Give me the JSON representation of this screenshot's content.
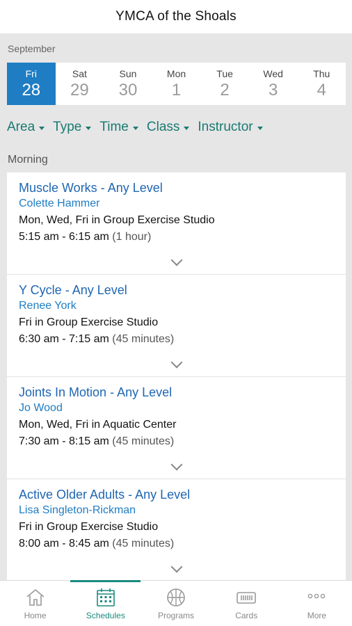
{
  "header": {
    "title": "YMCA of the Shoals"
  },
  "calendar": {
    "month": "September",
    "days": [
      {
        "dow": "Fri",
        "num": "28",
        "selected": true
      },
      {
        "dow": "Sat",
        "num": "29"
      },
      {
        "dow": "Sun",
        "num": "30"
      },
      {
        "dow": "Mon",
        "num": "1"
      },
      {
        "dow": "Tue",
        "num": "2"
      },
      {
        "dow": "Wed",
        "num": "3"
      },
      {
        "dow": "Thu",
        "num": "4"
      }
    ]
  },
  "filters": [
    "Area",
    "Type",
    "Time",
    "Class",
    "Instructor"
  ],
  "section": {
    "label": "Morning"
  },
  "classes": [
    {
      "title": "Muscle Works - Any Level",
      "instructor": "Colette Hammer",
      "days": "Mon, Wed, Fri",
      "in": "in",
      "location": "Group Exercise Studio",
      "time": "5:15 am - 6:15 am",
      "duration": "(1 hour)"
    },
    {
      "title": "Y Cycle - Any Level",
      "instructor": "Renee York",
      "days": "Fri",
      "in": "in",
      "location": "Group Exercise Studio",
      "time": "6:30 am - 7:15 am",
      "duration": "(45 minutes)"
    },
    {
      "title": "Joints In Motion - Any Level",
      "instructor": "Jo Wood",
      "days": "Mon, Wed, Fri",
      "in": "in",
      "location": "Aquatic Center",
      "time": "7:30 am - 8:15 am",
      "duration": "(45 minutes)"
    },
    {
      "title": "Active Older Adults - Any Level",
      "instructor": "Lisa Singleton-Rickman",
      "days": "Fri",
      "in": "in",
      "location": "Group Exercise Studio",
      "time": "8:00 am - 8:45 am",
      "duration": "(45 minutes)"
    }
  ],
  "tabs": [
    {
      "label": "Home",
      "icon": "home-icon"
    },
    {
      "label": "Schedules",
      "icon": "calendar-icon",
      "active": true
    },
    {
      "label": "Programs",
      "icon": "basketball-icon"
    },
    {
      "label": "Cards",
      "icon": "card-icon"
    },
    {
      "label": "More",
      "icon": "more-icon"
    }
  ],
  "colors": {
    "accent": "#1f7dc4",
    "filter": "#1a7a72",
    "tab_active": "#1a8a7f"
  }
}
